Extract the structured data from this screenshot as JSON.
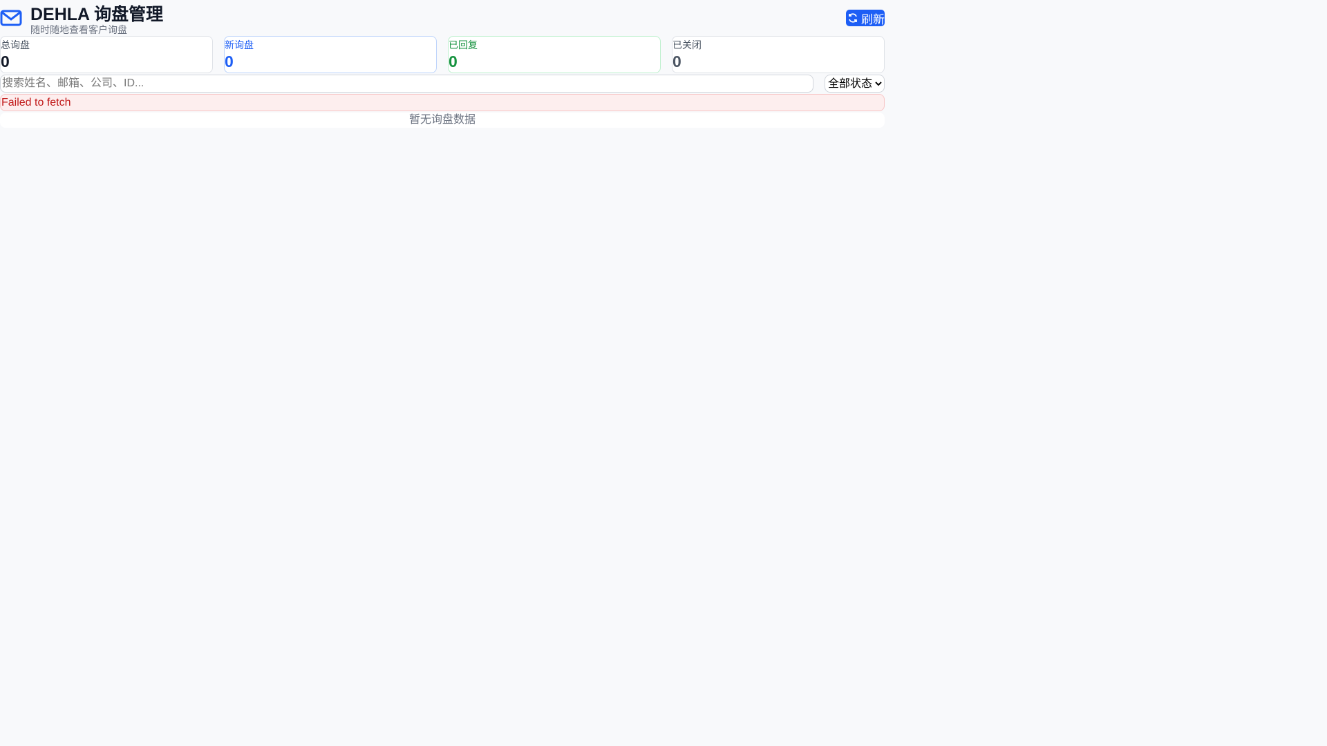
{
  "header": {
    "title": "DEHLA 询盘管理",
    "subtitle": "随时随地查看客户询盘",
    "refresh_label": "刷新"
  },
  "stats": [
    {
      "label": "总询盘",
      "value": "0"
    },
    {
      "label": "新询盘",
      "value": "0"
    },
    {
      "label": "已回复",
      "value": "0"
    },
    {
      "label": "已关闭",
      "value": "0"
    }
  ],
  "search": {
    "placeholder": "搜索姓名、邮箱、公司、ID...",
    "value": ""
  },
  "status_filter": {
    "selected": "全部状态"
  },
  "error": "Failed to fetch",
  "empty_text": "暂无询盘数据",
  "colors": {
    "accent": "#1d5ef5",
    "success": "#16923f",
    "error": "#c11a1a"
  }
}
